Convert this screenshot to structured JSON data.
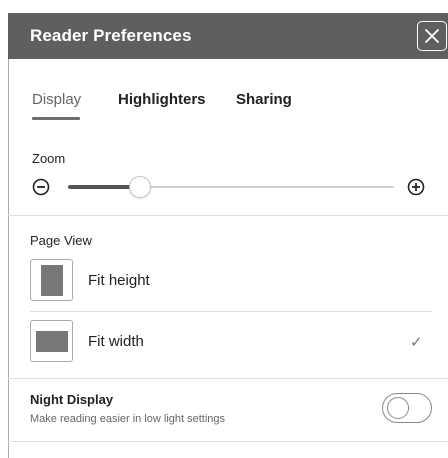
{
  "dialog": {
    "title": "Reader Preferences"
  },
  "tabs": [
    {
      "label": "Display",
      "selected": true
    },
    {
      "label": "Highlighters",
      "selected": false
    },
    {
      "label": "Sharing",
      "selected": false
    }
  ],
  "zoom": {
    "label": "Zoom",
    "level_fraction": 0.22
  },
  "page_view": {
    "label": "Page View",
    "options": [
      {
        "label": "Fit height",
        "selected": false
      },
      {
        "label": "Fit width",
        "selected": true
      }
    ],
    "check_glyph": "✓"
  },
  "night_display": {
    "title": "Night Display",
    "subtitle": "Make reading easier in low light settings",
    "enabled": false
  },
  "icons": {
    "close": "close-icon",
    "zoom_out": "minus-circle-icon",
    "zoom_in": "plus-circle-icon",
    "fit_height": "fit-height-icon",
    "fit_width": "fit-width-icon",
    "check": "check-icon"
  },
  "colors": {
    "header_bg": "#5f5f5f",
    "header_text": "#ffffff",
    "slider_fill": "#555555",
    "tab_indicator": "#6e6e6e"
  }
}
